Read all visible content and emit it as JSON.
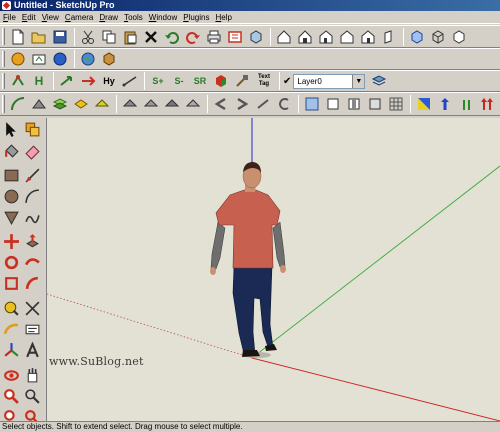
{
  "window": {
    "title": "Untitled - SketchUp Pro"
  },
  "menu": [
    "File",
    "Edit",
    "View",
    "Camera",
    "Draw",
    "Tools",
    "Window",
    "Plugins",
    "Help"
  ],
  "toolbar": {
    "row1_icons": [
      "new-icon",
      "open-icon",
      "save-icon",
      "cut-icon",
      "copy-icon",
      "paste-icon",
      "erase-icon",
      "undo-icon",
      "redo-icon",
      "print-icon",
      "model-info-icon",
      "get-models-icon",
      "share-model-icon",
      "component-icon",
      "get-photo-texture-icon",
      "iso-view-icon",
      "top-view-icon",
      "front-view-icon",
      "right-view-icon",
      "back-view-icon",
      "left-view-icon",
      "xray-icon",
      "wireframe-icon",
      "hidden-line-icon"
    ],
    "layer_checked": "✔",
    "layer_name": "Layer0",
    "text_tag": "Text Tag",
    "s_buttons": [
      "S+",
      "S-",
      "SR"
    ],
    "h_buttons": [
      "H",
      "Hy"
    ]
  },
  "viewport": {
    "background": "#e2e1d3",
    "axis_colors": {
      "blue": "#2222cc",
      "green": "#3caa3c",
      "red": "#cc2222"
    },
    "watermark": "www.SuBlog.net"
  },
  "status": {
    "text": "Select objects. Shift to extend select. Drag mouse to select multiple."
  }
}
